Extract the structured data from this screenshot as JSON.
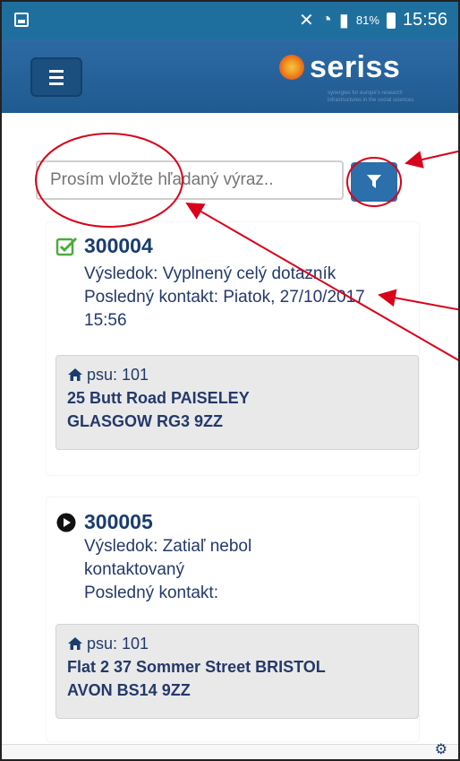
{
  "statusbar": {
    "signal_text": "81%",
    "time": "15:56"
  },
  "header": {
    "logo_text": "seriss",
    "logo_subtext": "synergies for europe's research infrastructures in the social sciences"
  },
  "search": {
    "placeholder": "Prosím vložte hľadaný výraz.."
  },
  "cases": [
    {
      "id": "300004",
      "status_icon": "check-square-icon",
      "result": "Výsledok: Vyplnený celý dotazník",
      "last_contact": "Posledný kontakt: Piatok, 27/10/2017 15:56",
      "psu": "psu: 101",
      "address_line1": "25 Butt Road PAISELEY",
      "address_line2": "GLASGOW RG3 9ZZ"
    },
    {
      "id": "300005",
      "status_icon": "play-circle-icon",
      "result": "Výsledok: Zatiaľ nebol kontaktovaný",
      "last_contact": "Posledný kontakt:",
      "psu": "psu: 101",
      "address_line1": "Flat 2 37 Sommer Street BRISTOL",
      "address_line2": "AVON BS14 9ZZ"
    }
  ],
  "colors": {
    "statusbar": "#1f6f9e",
    "appbar": "#2d6aa5",
    "accent": "#2b6fab",
    "text": "#24396a",
    "annotation": "#d9001b"
  }
}
